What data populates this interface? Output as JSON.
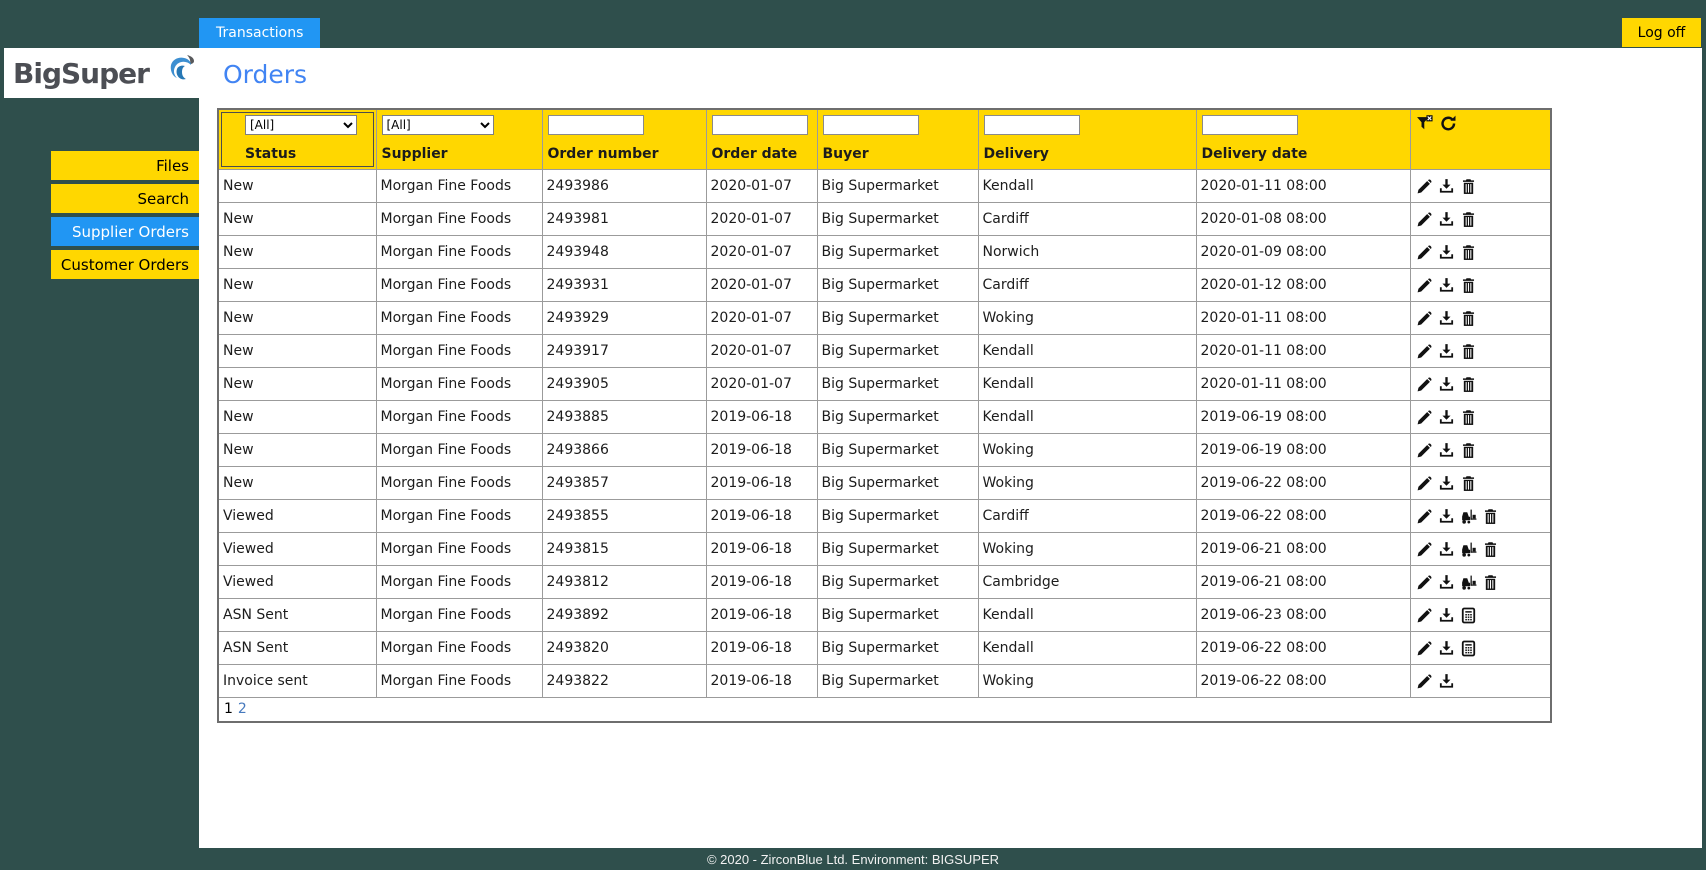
{
  "app": {
    "logo_text": "BigSuper",
    "tab_label": "Transactions",
    "logoff_label": "Log off",
    "footer_text": "© 2020 - ZirconBlue Ltd. Environment: BIGSUPER"
  },
  "colors": {
    "background_teal": "#2f4f4c",
    "accent_yellow": "#ffd700",
    "accent_blue": "#2196f3",
    "title_blue": "#4184f3",
    "pager_link_blue": "#4679bd"
  },
  "sidebar": {
    "items": [
      {
        "label": "Files",
        "active": false
      },
      {
        "label": "Search",
        "active": false
      },
      {
        "label": "Supplier Orders",
        "active": true
      },
      {
        "label": "Customer Orders",
        "active": false
      }
    ]
  },
  "page": {
    "title": "Orders"
  },
  "icons": {
    "edit": "pencil-icon",
    "download": "download-icon",
    "dispatch": "forklift-icon",
    "delete": "trash-icon",
    "invoice": "calculator-icon",
    "filter": "funnel-filter-icon",
    "refresh": "refresh-icon"
  },
  "table": {
    "columns": [
      "Status",
      "Supplier",
      "Order number",
      "Order date",
      "Buyer",
      "Delivery",
      "Delivery date"
    ],
    "filters": {
      "status_dropdown": "[All]",
      "supplier_dropdown": "[All]",
      "order_number_value": "",
      "order_date_value": "",
      "buyer_value": "",
      "delivery_value": "",
      "delivery_date_value": ""
    },
    "rows": [
      {
        "status": "New",
        "supplier": "Morgan Fine Foods",
        "order_number": "2493986",
        "order_date": "2020-01-07",
        "buyer": "Big Supermarket",
        "delivery": "Kendall",
        "delivery_date": "2020-01-11 08:00",
        "actions": [
          "edit",
          "download",
          "delete"
        ]
      },
      {
        "status": "New",
        "supplier": "Morgan Fine Foods",
        "order_number": "2493981",
        "order_date": "2020-01-07",
        "buyer": "Big Supermarket",
        "delivery": "Cardiff",
        "delivery_date": "2020-01-08 08:00",
        "actions": [
          "edit",
          "download",
          "delete"
        ]
      },
      {
        "status": "New",
        "supplier": "Morgan Fine Foods",
        "order_number": "2493948",
        "order_date": "2020-01-07",
        "buyer": "Big Supermarket",
        "delivery": "Norwich",
        "delivery_date": "2020-01-09 08:00",
        "actions": [
          "edit",
          "download",
          "delete"
        ]
      },
      {
        "status": "New",
        "supplier": "Morgan Fine Foods",
        "order_number": "2493931",
        "order_date": "2020-01-07",
        "buyer": "Big Supermarket",
        "delivery": "Cardiff",
        "delivery_date": "2020-01-12 08:00",
        "actions": [
          "edit",
          "download",
          "delete"
        ]
      },
      {
        "status": "New",
        "supplier": "Morgan Fine Foods",
        "order_number": "2493929",
        "order_date": "2020-01-07",
        "buyer": "Big Supermarket",
        "delivery": "Woking",
        "delivery_date": "2020-01-11 08:00",
        "actions": [
          "edit",
          "download",
          "delete"
        ]
      },
      {
        "status": "New",
        "supplier": "Morgan Fine Foods",
        "order_number": "2493917",
        "order_date": "2020-01-07",
        "buyer": "Big Supermarket",
        "delivery": "Kendall",
        "delivery_date": "2020-01-11 08:00",
        "actions": [
          "edit",
          "download",
          "delete"
        ]
      },
      {
        "status": "New",
        "supplier": "Morgan Fine Foods",
        "order_number": "2493905",
        "order_date": "2020-01-07",
        "buyer": "Big Supermarket",
        "delivery": "Kendall",
        "delivery_date": "2020-01-11 08:00",
        "actions": [
          "edit",
          "download",
          "delete"
        ]
      },
      {
        "status": "New",
        "supplier": "Morgan Fine Foods",
        "order_number": "2493885",
        "order_date": "2019-06-18",
        "buyer": "Big Supermarket",
        "delivery": "Kendall",
        "delivery_date": "2019-06-19 08:00",
        "actions": [
          "edit",
          "download",
          "delete"
        ]
      },
      {
        "status": "New",
        "supplier": "Morgan Fine Foods",
        "order_number": "2493866",
        "order_date": "2019-06-18",
        "buyer": "Big Supermarket",
        "delivery": "Woking",
        "delivery_date": "2019-06-19 08:00",
        "actions": [
          "edit",
          "download",
          "delete"
        ]
      },
      {
        "status": "New",
        "supplier": "Morgan Fine Foods",
        "order_number": "2493857",
        "order_date": "2019-06-18",
        "buyer": "Big Supermarket",
        "delivery": "Woking",
        "delivery_date": "2019-06-22 08:00",
        "actions": [
          "edit",
          "download",
          "delete"
        ]
      },
      {
        "status": "Viewed",
        "supplier": "Morgan Fine Foods",
        "order_number": "2493855",
        "order_date": "2019-06-18",
        "buyer": "Big Supermarket",
        "delivery": "Cardiff",
        "delivery_date": "2019-06-22 08:00",
        "actions": [
          "edit",
          "download",
          "dispatch",
          "delete"
        ]
      },
      {
        "status": "Viewed",
        "supplier": "Morgan Fine Foods",
        "order_number": "2493815",
        "order_date": "2019-06-18",
        "buyer": "Big Supermarket",
        "delivery": "Woking",
        "delivery_date": "2019-06-21 08:00",
        "actions": [
          "edit",
          "download",
          "dispatch",
          "delete"
        ]
      },
      {
        "status": "Viewed",
        "supplier": "Morgan Fine Foods",
        "order_number": "2493812",
        "order_date": "2019-06-18",
        "buyer": "Big Supermarket",
        "delivery": "Cambridge",
        "delivery_date": "2019-06-21 08:00",
        "actions": [
          "edit",
          "download",
          "dispatch",
          "delete"
        ]
      },
      {
        "status": "ASN Sent",
        "supplier": "Morgan Fine Foods",
        "order_number": "2493892",
        "order_date": "2019-06-18",
        "buyer": "Big Supermarket",
        "delivery": "Kendall",
        "delivery_date": "2019-06-23 08:00",
        "actions": [
          "edit",
          "download",
          "invoice"
        ]
      },
      {
        "status": "ASN Sent",
        "supplier": "Morgan Fine Foods",
        "order_number": "2493820",
        "order_date": "2019-06-18",
        "buyer": "Big Supermarket",
        "delivery": "Kendall",
        "delivery_date": "2019-06-22 08:00",
        "actions": [
          "edit",
          "download",
          "invoice"
        ]
      },
      {
        "status": "Invoice sent",
        "supplier": "Morgan Fine Foods",
        "order_number": "2493822",
        "order_date": "2019-06-18",
        "buyer": "Big Supermarket",
        "delivery": "Woking",
        "delivery_date": "2019-06-22 08:00",
        "actions": [
          "edit",
          "download"
        ]
      }
    ],
    "pagination": {
      "current_page": "1",
      "other_page": "2"
    }
  }
}
